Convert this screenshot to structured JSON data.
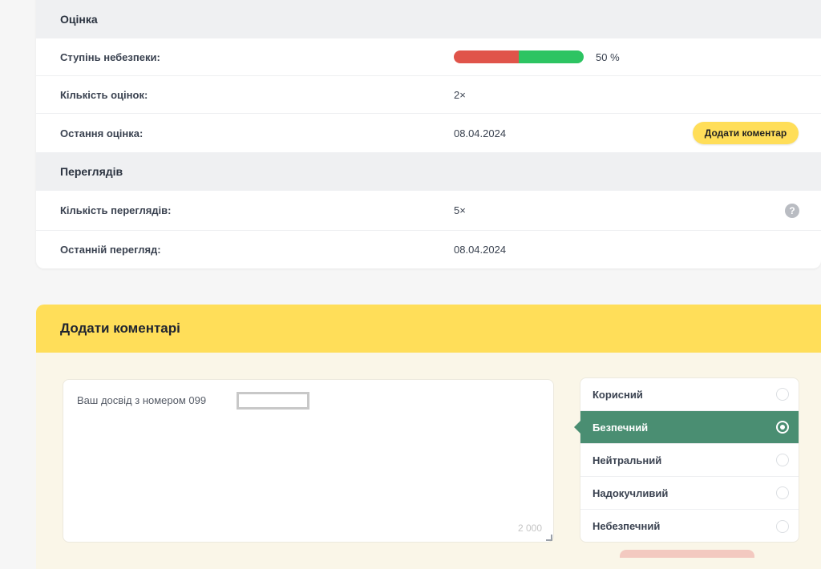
{
  "rating_section": {
    "title": "Оцінка",
    "danger_label": "Ступінь небезпеки:",
    "danger_percent": "50 %",
    "danger_fraction": 0.5,
    "count_label": "Кількість оцінок:",
    "count_value": "2×",
    "last_label": "Остання оцінка:",
    "last_value": "08.04.2024",
    "add_comment_button": "Додати коментар"
  },
  "views_section": {
    "title": "Переглядів",
    "count_label": "Кількість переглядів:",
    "count_value": "5×",
    "last_label": "Останній перегляд:",
    "last_value": "08.04.2024"
  },
  "comment_section": {
    "title": "Додати коментарі",
    "textarea_text": "Ваш досвід з номером 099",
    "char_counter": "2 000",
    "ratings": [
      {
        "label": "Корисний",
        "selected": false
      },
      {
        "label": "Безпечний",
        "selected": true
      },
      {
        "label": "Нейтральний",
        "selected": false
      },
      {
        "label": "Надокучливий",
        "selected": false
      },
      {
        "label": "Небезпечний",
        "selected": false
      }
    ]
  },
  "colors": {
    "accent_yellow": "#ffde59",
    "selected_green": "#4a8e72",
    "danger_red": "#e0544a",
    "safe_green": "#2dc462"
  }
}
